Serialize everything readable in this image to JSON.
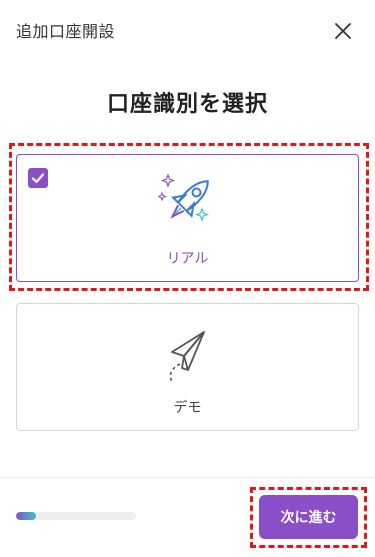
{
  "header": {
    "title": "追加口座開設"
  },
  "page": {
    "title": "口座識別を選択"
  },
  "options": [
    {
      "label": "リアル",
      "selected": true,
      "icon": "rocket-icon"
    },
    {
      "label": "デモ",
      "selected": false,
      "icon": "paper-plane-icon"
    }
  ],
  "footer": {
    "progress_fraction": 0.17,
    "next_label": "次に進む"
  },
  "colors": {
    "accent": "#8a4fc8",
    "teal": "#35c6c9",
    "highlight": "#e01818"
  }
}
